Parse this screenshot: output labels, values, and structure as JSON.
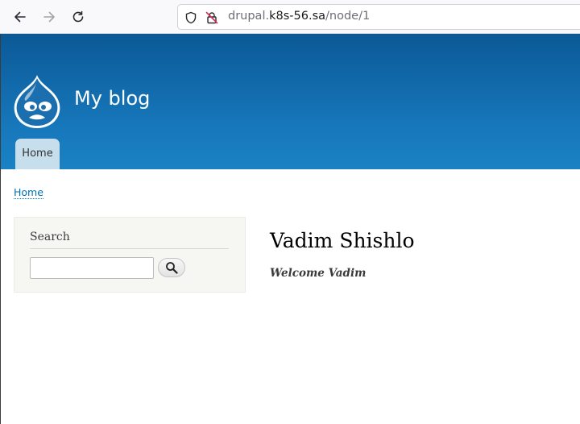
{
  "browser": {
    "url_prefix": "drupal.",
    "url_host": "k8s-56.sa",
    "url_path": "/node/1",
    "back_icon": "arrow-left-icon",
    "forward_icon": "arrow-right-icon",
    "reload_icon": "reload-icon",
    "shield_icon": "shield-icon",
    "insecure_icon": "insecure-lock-icon"
  },
  "header": {
    "site_name": "My blog",
    "logo_icon": "drupal-drop-logo",
    "tabs": [
      {
        "label": "Home"
      }
    ]
  },
  "breadcrumb": {
    "items": [
      {
        "label": "Home"
      }
    ]
  },
  "sidebar": {
    "search_block": {
      "title": "Search",
      "input_value": "",
      "button_icon": "search-icon"
    }
  },
  "main": {
    "title": "Vadim Shishlo",
    "body": "Welcome Vadim"
  },
  "colors": {
    "header_top": "#0b5996",
    "header_bottom": "#1a82c4",
    "tab_background": "#c7deed",
    "link": "#0071b3"
  }
}
